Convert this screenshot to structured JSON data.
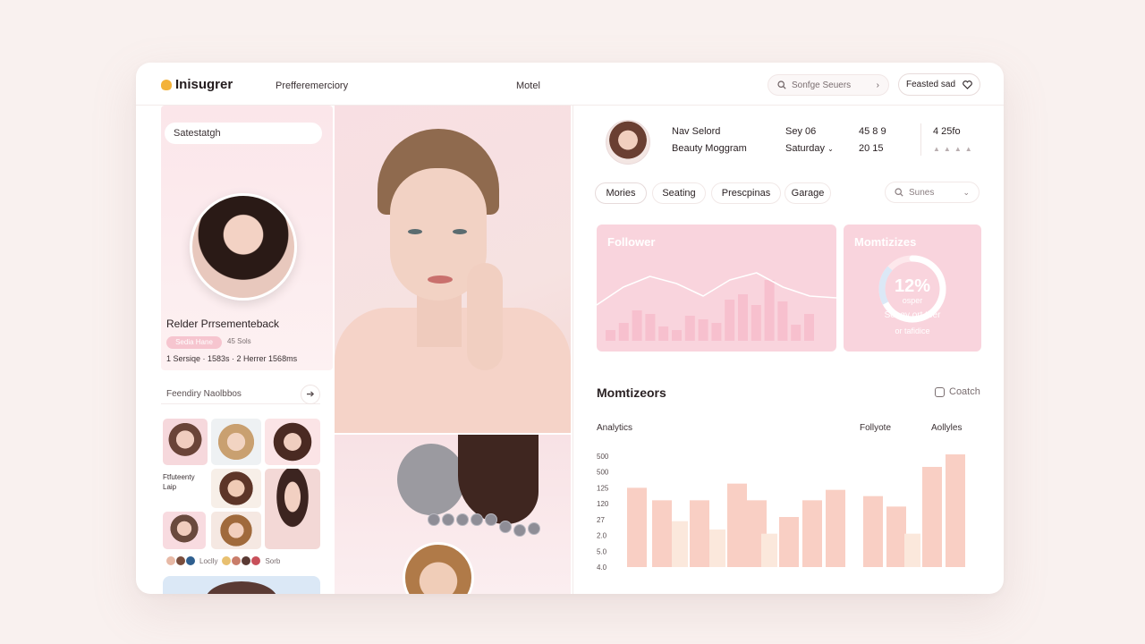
{
  "header": {
    "brand": "Inisugrer",
    "nav": [
      "Prefferemerciory",
      "Motel"
    ],
    "search_placeholder": "Sonfge Seuers",
    "action_button": "Feasted sad"
  },
  "left": {
    "profile_input": "Satestatgh",
    "profile_name": "Relder Prrsementeback",
    "tag": "Sedia Hane",
    "tag_count": "45 Sols",
    "stats": "1 Sersiqe · 1583s · 2 Herrer 1568ms",
    "feed_link": "Feendiry Naolbbos",
    "thumb_caption": "Ftfuteenty\nLaip",
    "dots_text": [
      "Loclly",
      "Sorb"
    ]
  },
  "right": {
    "user_line1": "Nav Selord",
    "user_line2": "Beauty Moggram",
    "date_line1": "Sey 06",
    "date_line2": "Saturday",
    "stat1": "45 8 9",
    "stat2": "20 15",
    "stat3": "4 25fo",
    "tabs": [
      "Mories",
      "Seating",
      "Prescpinas",
      "Garage"
    ],
    "series_select": "Sunes",
    "panel_follower_title": "Follower",
    "panel_monetize_title": "Momtizizes",
    "gauge_value": "12%",
    "gauge_sub": "osper",
    "gauge_caption1": "Seagy ort tber",
    "gauge_caption2": "or tafidice",
    "section_title": "Momtizeors",
    "switch_label": "Coatch",
    "chart_labels": [
      "Analytics",
      "Follyote",
      "Aollyles"
    ]
  },
  "colors": {
    "accent_pink": "#f9d4dd",
    "bar_peach": "#f9cfc4",
    "bar_cream": "#fbe8dc",
    "logo_yellow": "#f3b23a"
  },
  "chart_data": {
    "type": "bar",
    "y_tick_labels": [
      "500",
      "500",
      "125",
      "120",
      "27",
      "2.0",
      "5.0",
      "4.0"
    ],
    "series": [
      {
        "values": [
          190,
          160,
          160,
          200,
          160,
          120,
          160,
          185,
          170,
          145,
          240,
          270
        ]
      },
      {
        "values": [
          110,
          90,
          80,
          80
        ]
      }
    ],
    "follower_line": [
      20,
      40,
      52,
      44,
      30,
      48,
      56,
      40,
      30,
      28
    ],
    "follower_bars": [
      12,
      20,
      34,
      30,
      16,
      12,
      28,
      24,
      20,
      46,
      52,
      40,
      68,
      44,
      18,
      30
    ]
  }
}
